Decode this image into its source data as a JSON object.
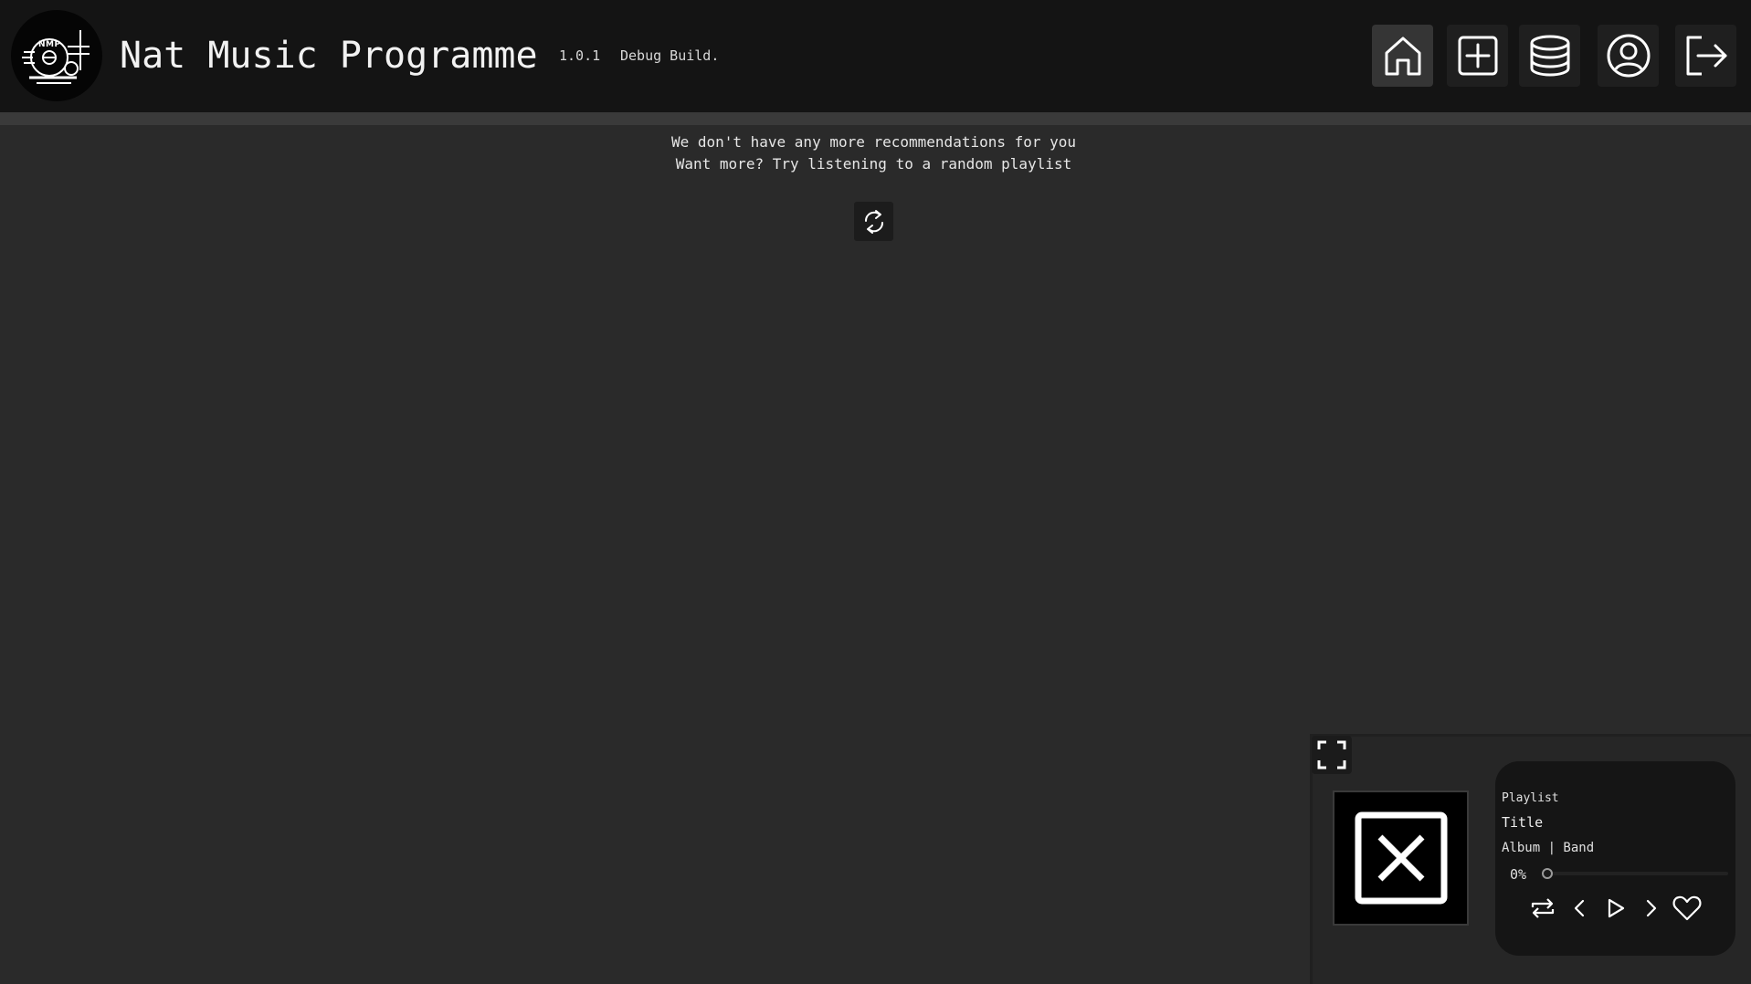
{
  "app": {
    "title": "Nat Music Programme",
    "version": "1.0.1",
    "build": "Debug Build.",
    "logo_text": "NMP"
  },
  "nav": [
    {
      "icon": "home-icon",
      "label": "Home",
      "active": true
    },
    {
      "icon": "plus-square-icon",
      "label": "Add",
      "active": false
    },
    {
      "icon": "database-icon",
      "label": "Database",
      "active": false
    },
    {
      "icon": "user-circle-icon",
      "label": "Account",
      "active": false
    },
    {
      "icon": "logout-icon",
      "label": "Log out",
      "active": false
    }
  ],
  "recommendations": {
    "empty_line_1": "We don't have any more recommendations for you",
    "empty_line_2": "Want more? Try listening to a random playlist",
    "refresh_icon": "refresh-icon"
  },
  "player": {
    "playlist_label": "Playlist",
    "title": "Title",
    "album_band": "Album | Band",
    "progress_text": "0%",
    "progress_fraction": 0,
    "artwork_icon": "no-image-icon",
    "controls": [
      "repeat-icon",
      "previous-icon",
      "play-icon",
      "next-icon",
      "heart-icon"
    ]
  },
  "colors": {
    "header_bg": "#141414",
    "page_bg": "#2a2a2a",
    "player_card_bg": "#151515",
    "text": "#e8e8e8"
  }
}
